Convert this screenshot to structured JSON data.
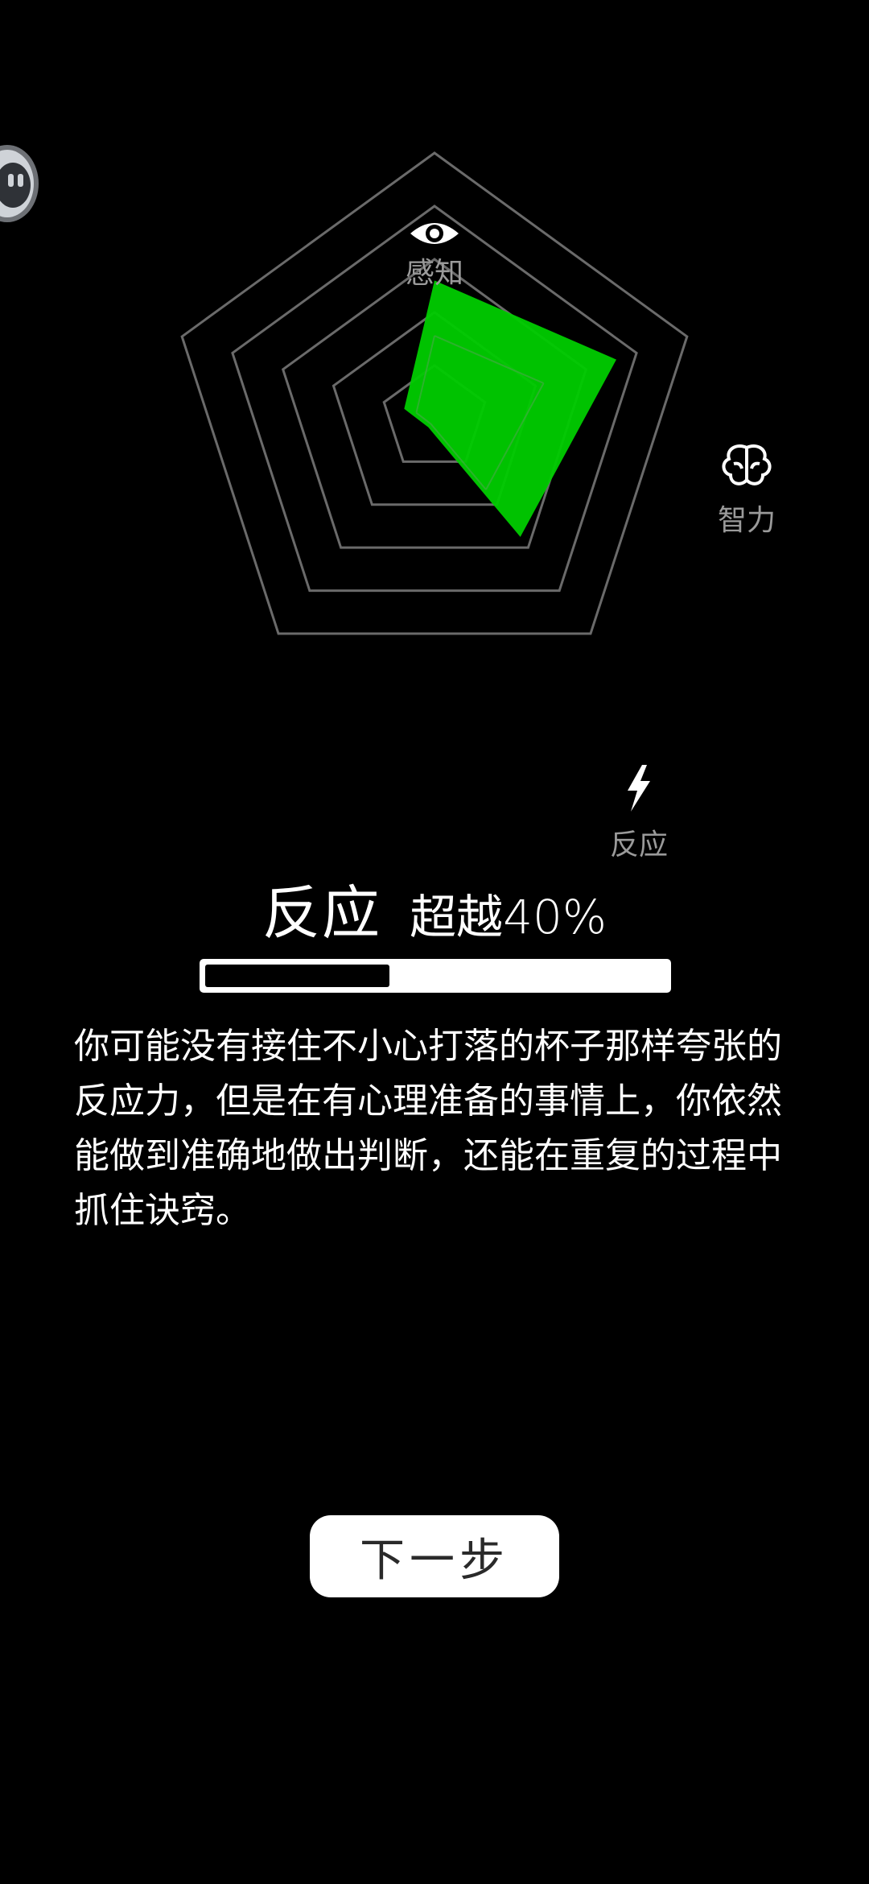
{
  "radar": {
    "axes": [
      {
        "label": "感知",
        "icon": "eye-icon"
      },
      {
        "label": "智力",
        "icon": "brain-icon"
      },
      {
        "label": "反应",
        "icon": "lightning-icon"
      }
    ],
    "fill_color": "#00cc00"
  },
  "result": {
    "title": "反应",
    "score": "超越40%",
    "progress_percent": 40
  },
  "description": "你可能没有接住不小心打落的杯子那样夸张的反应力，但是在有心理准备的事情上，你依然能做到准确地做出判断，还能在重复的过程中抓住诀窍。",
  "next_button_label": "下一步"
}
